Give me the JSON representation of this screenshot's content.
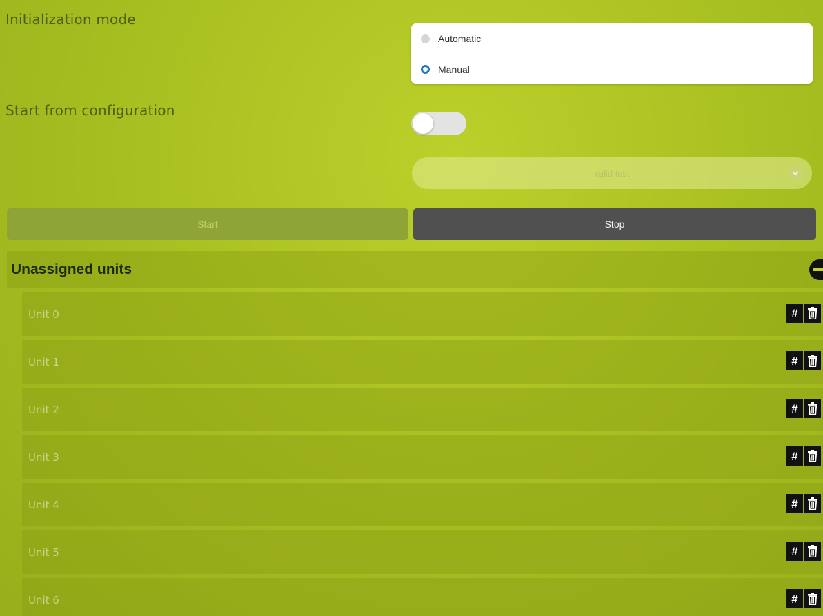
{
  "settings": {
    "init_mode_label": "Initialization mode",
    "init_mode_options": [
      {
        "label": "Automatic",
        "selected": false
      },
      {
        "label": "Manual",
        "selected": true
      }
    ],
    "start_from_config_label": "Start from configuration",
    "start_from_config_enabled": false,
    "config_select_value": "valid test"
  },
  "actions": {
    "start_label": "Start",
    "stop_label": "Stop"
  },
  "section": {
    "title": "Unassigned units",
    "expanded": true
  },
  "units": [
    {
      "name": "Unit 0"
    },
    {
      "name": "Unit 1"
    },
    {
      "name": "Unit 2"
    },
    {
      "name": "Unit 3"
    },
    {
      "name": "Unit 4"
    },
    {
      "name": "Unit 5"
    },
    {
      "name": "Unit 6"
    }
  ],
  "icons": {
    "unit_id": "hash-icon",
    "unit_delete": "trash-icon",
    "section_toggle": "collapse-icon",
    "select": "chevron-down-icon"
  },
  "colors": {
    "accent": "#2476c2",
    "stop_button": "#505050"
  }
}
